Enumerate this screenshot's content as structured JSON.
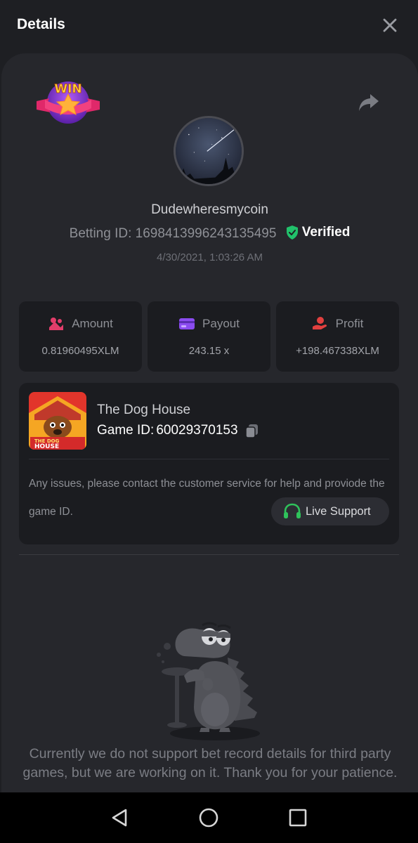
{
  "header": {
    "title": "Details",
    "close_icon": "close-icon"
  },
  "bet": {
    "badge_text": "WIN",
    "username": "Dudewheresmycoin",
    "betting_id_label": "Betting ID:",
    "betting_id": "1698413996243135495",
    "verified_label": "Verified",
    "datetime": "4/30/2021, 1:03:26 AM"
  },
  "stats": [
    {
      "label": "Amount",
      "value": "0.81960495XLM",
      "icon": "coin-stack-icon",
      "color": "#e23d6a"
    },
    {
      "label": "Payout",
      "value": "243.15 x",
      "icon": "wallet-card-icon",
      "color": "#8b4cf0"
    },
    {
      "label": "Profit",
      "value": "+198.467338XLM",
      "icon": "hand-coin-icon",
      "color": "#e2403f"
    }
  ],
  "game": {
    "name": "The Dog House",
    "id_label": "Game ID:",
    "id": "60029370153",
    "thumb_text_1": "THE DOG",
    "thumb_text_2": "HOUSE",
    "issues_text": "Any issues, please contact the customer service for help and proviode the game ID.",
    "support_label": "Live Support"
  },
  "notice": "Currently we do not support bet record details for third party games, but we are working on it. Thank you for your patience.",
  "colors": {
    "background": "#1e1f23",
    "panel": "#26272c",
    "card": "#1b1c20",
    "verified_green": "#21c16b",
    "support_green": "#2fc25b"
  }
}
